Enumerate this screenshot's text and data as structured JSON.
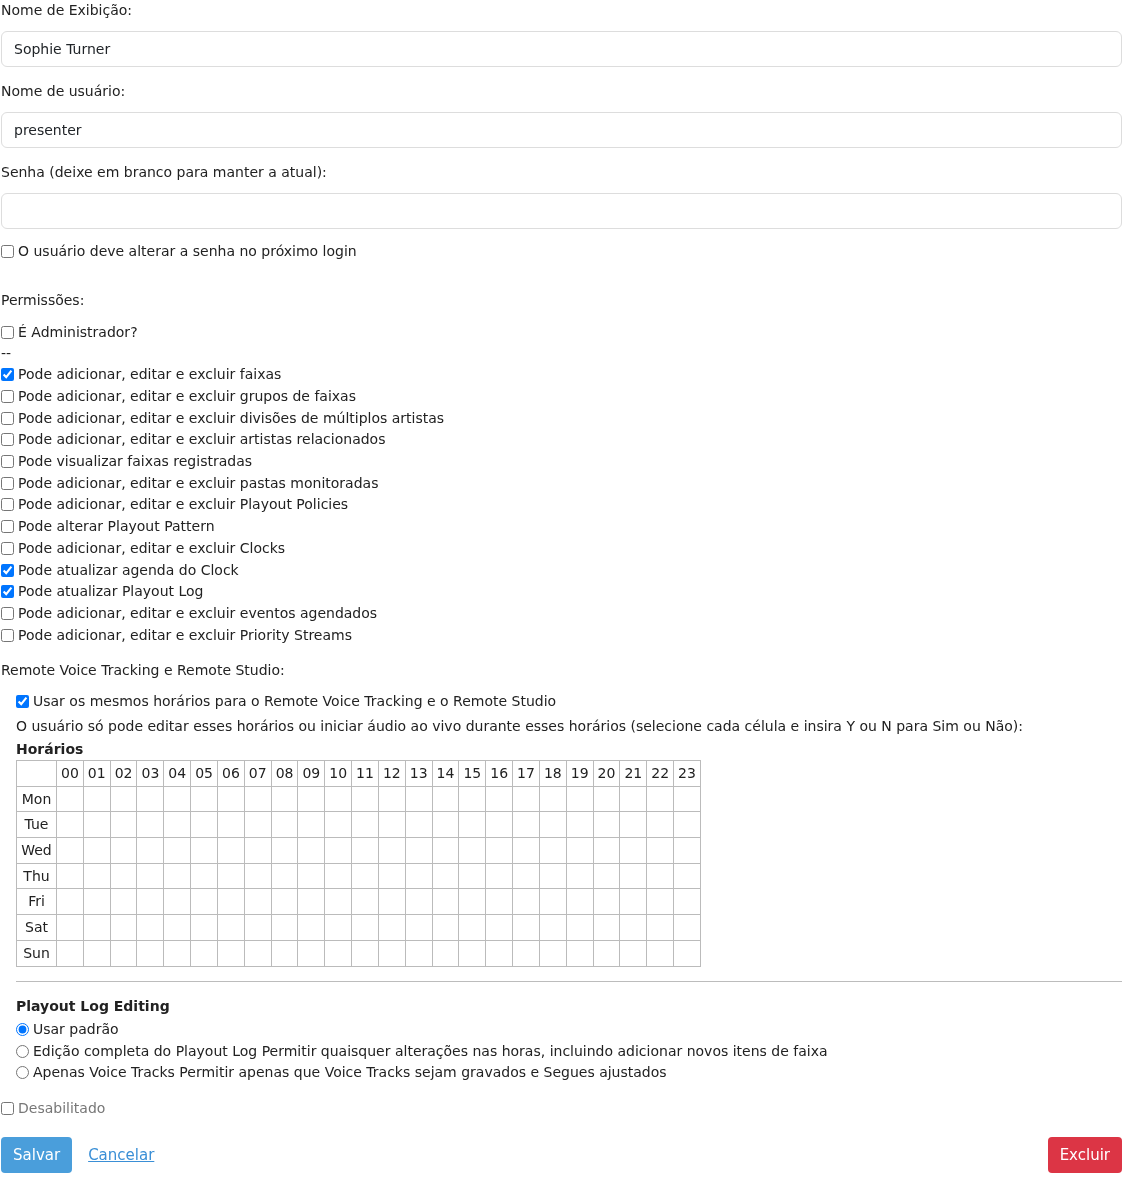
{
  "fields": [
    {
      "label": "Nome de Exibição:",
      "value": "Sophie Turner"
    },
    {
      "label": "Nome de usuário:",
      "value": "presenter"
    },
    {
      "label": "Senha (deixe em branco para manter a atual):"
    }
  ],
  "must_change_password": {
    "label": "O usuário deve alterar a senha no próximo login",
    "checked": false
  },
  "permissions": {
    "title": "Permissões:",
    "admin": {
      "label": "É Administrador?",
      "checked": false
    },
    "separator": "--",
    "items": [
      {
        "label": "Pode adicionar, editar e excluir faixas",
        "checked": true
      },
      {
        "label": "Pode adicionar, editar e excluir grupos de faixas",
        "checked": false
      },
      {
        "label": "Pode adicionar, editar e excluir divisões de múltiplos artistas",
        "checked": false
      },
      {
        "label": "Pode adicionar, editar e excluir artistas relacionados",
        "checked": false
      },
      {
        "label": "Pode visualizar faixas registradas",
        "checked": false
      },
      {
        "label": "Pode adicionar, editar e excluir pastas monitoradas",
        "checked": false
      },
      {
        "label": "Pode adicionar, editar e excluir Playout Policies",
        "checked": false
      },
      {
        "label": "Pode alterar Playout Pattern",
        "checked": false
      },
      {
        "label": "Pode adicionar, editar e excluir Clocks",
        "checked": false
      },
      {
        "label": "Pode atualizar agenda do Clock",
        "checked": true
      },
      {
        "label": "Pode atualizar Playout Log",
        "checked": true
      },
      {
        "label": "Pode adicionar, editar e excluir eventos agendados",
        "checked": false
      },
      {
        "label": "Pode adicionar, editar e excluir Priority Streams",
        "checked": false
      }
    ]
  },
  "remote": {
    "title": "Remote Voice Tracking e Remote Studio:",
    "same_hours": {
      "label": "Usar os mesmos horários para o Remote Voice Tracking e o Remote Studio",
      "checked": true
    },
    "note": "O usuário só pode editar esses horários ou iniciar áudio ao vivo durante esses horários (selecione cada célula e insira Y ou N para Sim ou Não):",
    "schedule_title": "Horários",
    "hours": [
      "00",
      "01",
      "02",
      "03",
      "04",
      "05",
      "06",
      "07",
      "08",
      "09",
      "10",
      "11",
      "12",
      "13",
      "14",
      "15",
      "16",
      "17",
      "18",
      "19",
      "20",
      "21",
      "22",
      "23"
    ],
    "days": [
      "Mon",
      "Tue",
      "Wed",
      "Thu",
      "Fri",
      "Sat",
      "Sun"
    ]
  },
  "playout_log_editing": {
    "title": "Playout Log Editing",
    "options": [
      {
        "label": "Usar padrão",
        "selected": true
      },
      {
        "label": "Edição completa do Playout Log Permitir quaisquer alterações nas horas, incluindo adicionar novos itens de faixa",
        "selected": false
      },
      {
        "label": "Apenas Voice Tracks Permitir apenas que Voice Tracks sejam gravados e Segues ajustados",
        "selected": false
      }
    ]
  },
  "disabled": {
    "label": "Desabilitado",
    "checked": false
  },
  "buttons": {
    "save": "Salvar",
    "cancel": "Cancelar",
    "delete": "Excluir"
  }
}
